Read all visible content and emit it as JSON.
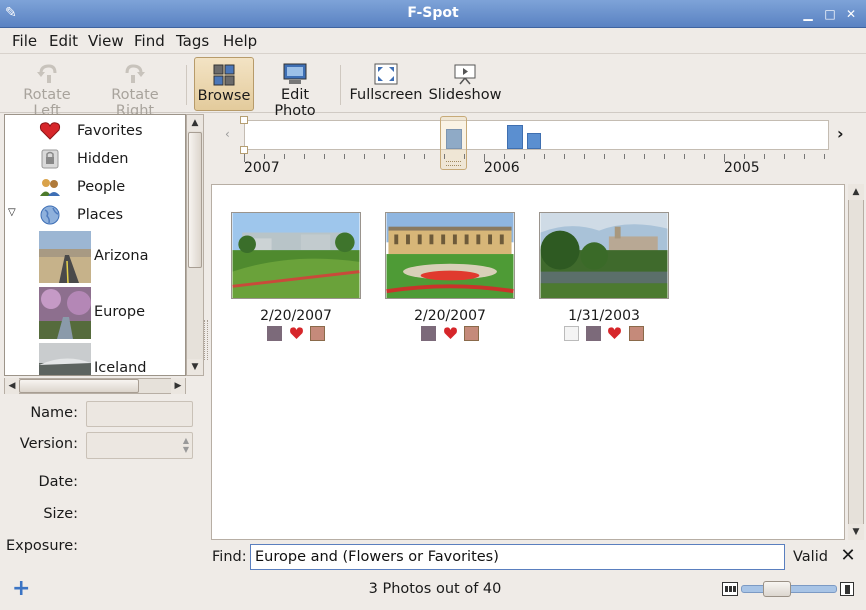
{
  "window": {
    "title": "F-Spot"
  },
  "menu": [
    "File",
    "Edit",
    "View",
    "Find",
    "Tags",
    "Help"
  ],
  "toolbar": {
    "rotate_left": "Rotate Left",
    "rotate_right": "Rotate Right",
    "browse": "Browse",
    "edit_photo": "Edit Photo",
    "fullscreen": "Fullscreen",
    "slideshow": "Slideshow"
  },
  "tags": {
    "favorites": "Favorites",
    "hidden": "Hidden",
    "people": "People",
    "places": "Places",
    "places_children": [
      "Arizona",
      "Europe",
      "Iceland"
    ]
  },
  "info": {
    "name_label": "Name:",
    "version_label": "Version:",
    "date_label": "Date:",
    "size_label": "Size:",
    "exposure_label": "Exposure:"
  },
  "timeline": {
    "years": [
      "2007",
      "2006",
      "2005"
    ]
  },
  "photos": [
    {
      "date": "2/20/2007",
      "tags": [
        "people",
        "favorites",
        "flowers"
      ]
    },
    {
      "date": "2/20/2007",
      "tags": [
        "people",
        "favorites",
        "flowers"
      ]
    },
    {
      "date": "1/31/2003",
      "tags": [
        "hidden",
        "people",
        "favorites",
        "flowers"
      ]
    }
  ],
  "find": {
    "label": "Find:",
    "query": "Europe and (Flowers or Favorites)",
    "status": "Valid"
  },
  "status": {
    "text": "3 Photos out of 40"
  },
  "colors": {
    "titlebar": "#6a92cf",
    "timeline_bar": "#5b8fd0",
    "accent_active": "#e8d3a8"
  }
}
